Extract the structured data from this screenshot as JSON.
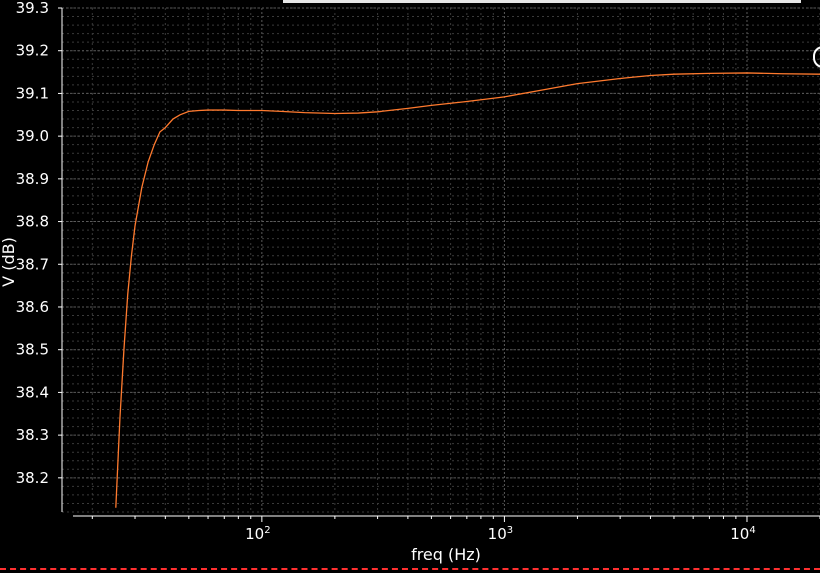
{
  "chart_data": {
    "type": "line",
    "title": "",
    "xlabel": "freq (Hz)",
    "ylabel": "V (dB)",
    "x_scale": "log",
    "xlim": [
      15,
      20000
    ],
    "ylim": [
      38.12,
      39.3
    ],
    "y_ticks": [
      38.2,
      38.3,
      38.4,
      38.5,
      38.6,
      38.7,
      38.8,
      38.9,
      39.0,
      39.1,
      39.2,
      39.3
    ],
    "x_ticks": [
      {
        "value": 100,
        "base": "10",
        "exp": "2"
      },
      {
        "value": 1000,
        "base": "10",
        "exp": "3"
      },
      {
        "value": 10000,
        "base": "10",
        "exp": "4"
      }
    ],
    "grid": true,
    "series": [
      {
        "color": "#ff7a2e",
        "x": [
          25,
          26,
          27,
          28,
          29,
          30,
          32,
          34,
          36,
          38,
          40,
          43,
          46,
          50,
          55,
          60,
          70,
          80,
          100,
          120,
          150,
          200,
          250,
          300,
          400,
          500,
          700,
          1000,
          1500,
          2000,
          3000,
          4000,
          5000,
          7000,
          10000,
          14000,
          20000
        ],
        "y": [
          38.13,
          38.34,
          38.5,
          38.63,
          38.72,
          38.79,
          38.88,
          38.94,
          38.98,
          39.01,
          39.02,
          39.04,
          39.05,
          39.058,
          39.06,
          39.061,
          39.061,
          39.06,
          39.06,
          39.058,
          39.055,
          39.053,
          39.054,
          39.057,
          39.065,
          39.072,
          39.081,
          39.092,
          39.11,
          39.123,
          39.135,
          39.142,
          39.145,
          39.147,
          39.148,
          39.146,
          39.145
        ]
      }
    ]
  }
}
